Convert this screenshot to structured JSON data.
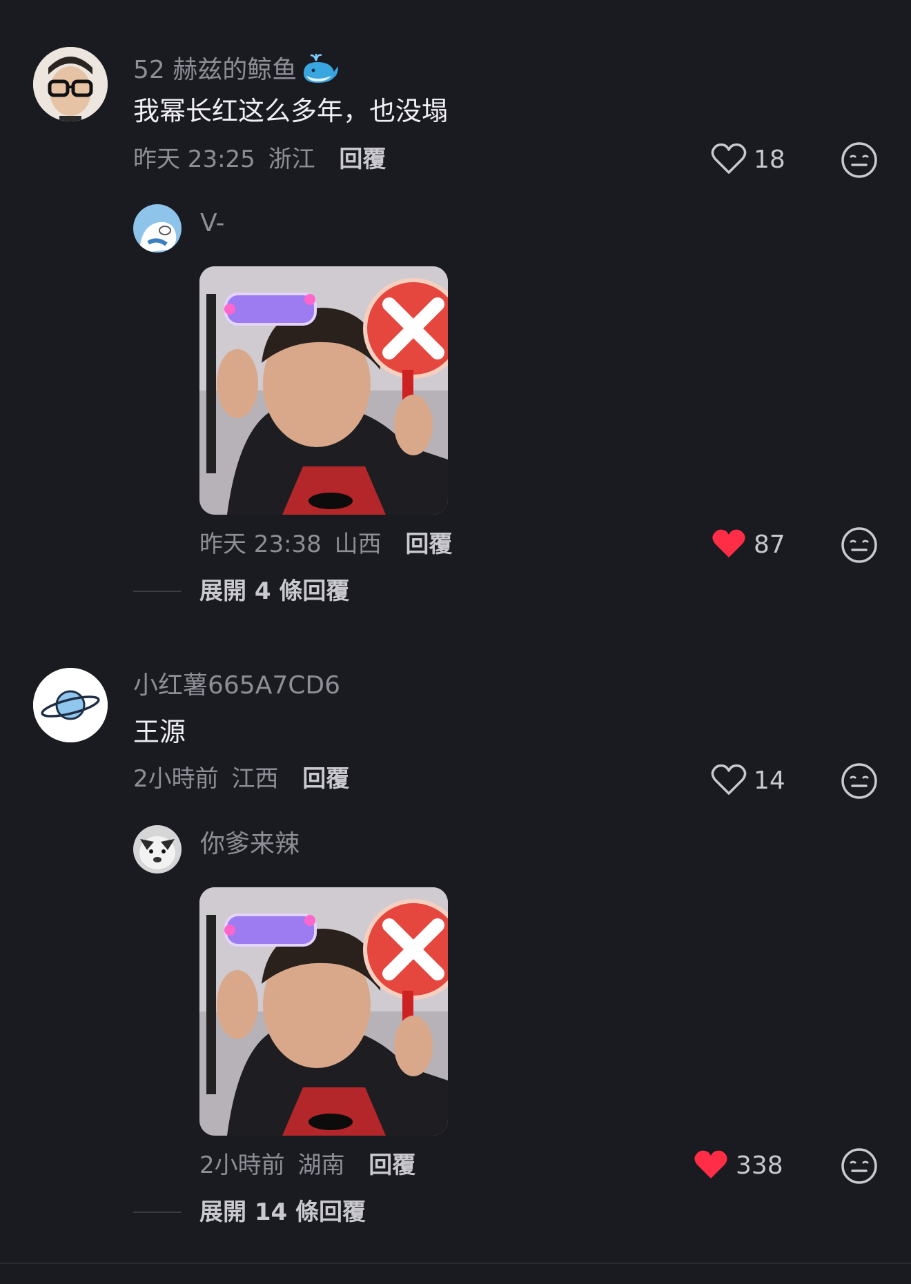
{
  "comments": [
    {
      "username": "52 赫兹的鲸鱼",
      "content": "我幂长红这么多年，也没塌",
      "time": "昨天 23:25",
      "location": "浙江",
      "reply_label": "回覆",
      "likes": "18",
      "liked": false,
      "reply": {
        "username": "V-",
        "time": "昨天 23:38",
        "location": "山西",
        "reply_label": "回覆",
        "likes": "87",
        "liked": true
      },
      "expand_label": "展開 4 條回覆"
    },
    {
      "username": "小红薯665A7CD6",
      "content": "王源",
      "time": "2小時前",
      "location": "江西",
      "reply_label": "回覆",
      "likes": "14",
      "liked": false,
      "reply": {
        "username": "你爹来辣",
        "time": "2小時前",
        "location": "湖南",
        "reply_label": "回覆",
        "likes": "338",
        "liked": true
      },
      "expand_label": "展開 14 條回覆"
    }
  ],
  "colors": {
    "background": "#1a1a21",
    "liked_heart": "#ff2d45",
    "muted_text": "#8e8e96"
  },
  "icons": {
    "like": "heart-outline-icon",
    "liked": "heart-filled-icon",
    "react": "neutral-face-icon",
    "username_badge": "whale-icon"
  }
}
